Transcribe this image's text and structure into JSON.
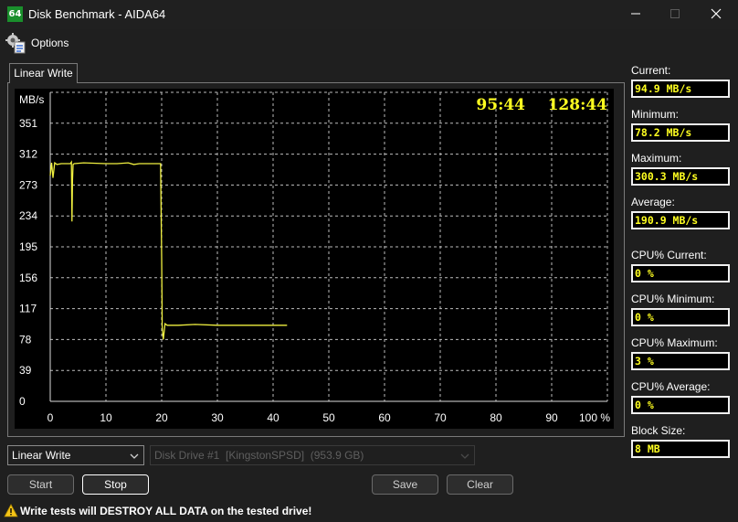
{
  "window": {
    "title": "Disk Benchmark - AIDA64",
    "icon_text": "64"
  },
  "menu": {
    "options_label": "Options"
  },
  "tab": {
    "label": "Linear Write"
  },
  "chart_data": {
    "type": "line",
    "ylabel": "MB/s",
    "y_ticks": [
      0,
      39,
      78,
      117,
      156,
      195,
      234,
      273,
      312,
      351
    ],
    "x_ticks": [
      0,
      10,
      20,
      30,
      40,
      50,
      60,
      70,
      80,
      90,
      100
    ],
    "x_unit": "%",
    "xlim": [
      0,
      100
    ],
    "ylim": [
      0,
      390
    ],
    "grid": true,
    "elapsed_time": "95:44",
    "total_time": "128:44",
    "line_color": "#f0f040",
    "series": [
      {
        "x": [
          0,
          0.25,
          0.5,
          0.8,
          1.2,
          2,
          3,
          3.6,
          3.8,
          3.9,
          4.0,
          4.1,
          4.3,
          6,
          10,
          12,
          14,
          15,
          16,
          18,
          19.5,
          19.8,
          20.0,
          20.1,
          20.3,
          20.6,
          21,
          23,
          26,
          30,
          35,
          40,
          42.5
        ],
        "y": [
          285,
          301,
          282,
          301,
          299,
          300,
          300,
          300,
          302,
          227,
          280,
          299,
          300,
          301,
          300,
          300,
          301,
          299,
          300,
          300,
          300,
          300,
          180,
          93,
          78,
          98,
          96,
          96,
          97,
          96,
          96,
          96,
          96
        ]
      }
    ]
  },
  "stats": {
    "current_label": "Current:",
    "current": "94.9 MB/s",
    "minimum_label": "Minimum:",
    "minimum": "78.2 MB/s",
    "maximum_label": "Maximum:",
    "maximum": "300.3 MB/s",
    "average_label": "Average:",
    "average": "190.9 MB/s",
    "cpu_current_label": "CPU% Current:",
    "cpu_current": "0 %",
    "cpu_minimum_label": "CPU% Minimum:",
    "cpu_minimum": "0 %",
    "cpu_maximum_label": "CPU% Maximum:",
    "cpu_maximum": "3 %",
    "cpu_average_label": "CPU% Average:",
    "cpu_average": "0 %",
    "block_size_label": "Block Size:",
    "block_size": "8 MB"
  },
  "controls": {
    "test_select": "Linear Write",
    "drive_select": "Disk Drive #1  [KingstonSPSD]  (953.9 GB)",
    "start": "Start",
    "stop": "Stop",
    "save": "Save",
    "clear": "Clear"
  },
  "warning": {
    "text": "Write tests will DESTROY ALL DATA on the tested drive!"
  }
}
